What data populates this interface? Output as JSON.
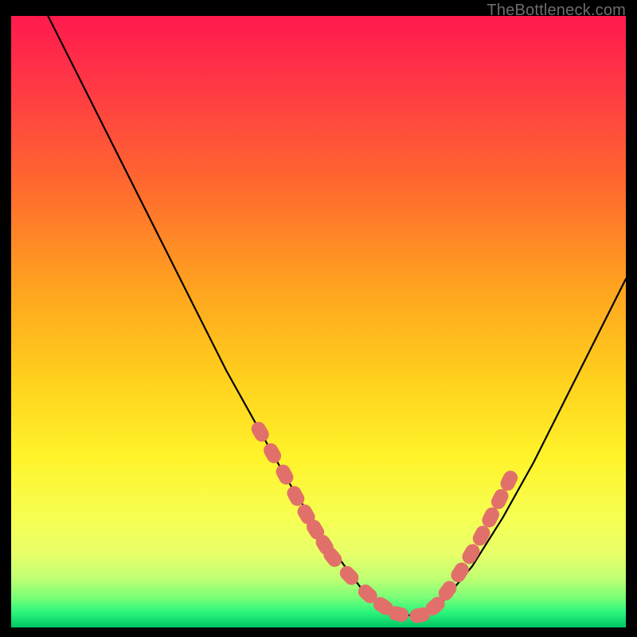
{
  "watermark": "TheBottleneck.com",
  "colors": {
    "bg": "#000000",
    "curve": "#000000",
    "marker_fill": "#e2706a",
    "marker_stroke": "#d05a55",
    "grad_top": "#ff1a4e",
    "grad_mid1": "#ff6a2e",
    "grad_mid2": "#ffd21e",
    "grad_mid3": "#fff32a",
    "grad_low1": "#f4ff6e",
    "grad_green1": "#8aff7a",
    "grad_green2": "#00e874",
    "grad_bottom": "#00c466"
  },
  "chart_data": {
    "type": "line",
    "title": "",
    "xlabel": "",
    "ylabel": "",
    "xlim": [
      0,
      100
    ],
    "ylim": [
      0,
      100
    ],
    "series": [
      {
        "name": "curve",
        "x": [
          6,
          10,
          15,
          20,
          25,
          30,
          35,
          40,
          45,
          50,
          55,
          58,
          61,
          64,
          67,
          70,
          75,
          80,
          85,
          90,
          95,
          100
        ],
        "y": [
          100,
          92,
          82,
          72,
          62,
          52,
          42,
          33,
          24,
          16,
          9,
          5,
          3,
          2,
          2,
          4,
          10,
          18,
          27,
          37,
          47,
          57
        ]
      }
    ],
    "markers": {
      "name": "highlight-points",
      "x": [
        40.5,
        42.5,
        44.5,
        46.3,
        48.0,
        49.5,
        51.0,
        52.3,
        55.0,
        58.0,
        60.5,
        63.0,
        66.5,
        69.0,
        71.0,
        73.0,
        74.8,
        76.5,
        78.0,
        79.5,
        81.0
      ],
      "y": [
        32.0,
        28.5,
        25.0,
        21.5,
        18.5,
        16.0,
        13.5,
        11.5,
        8.5,
        5.5,
        3.5,
        2.2,
        2.0,
        3.5,
        6.0,
        9.0,
        12.0,
        15.0,
        18.0,
        21.0,
        24.0
      ]
    }
  }
}
